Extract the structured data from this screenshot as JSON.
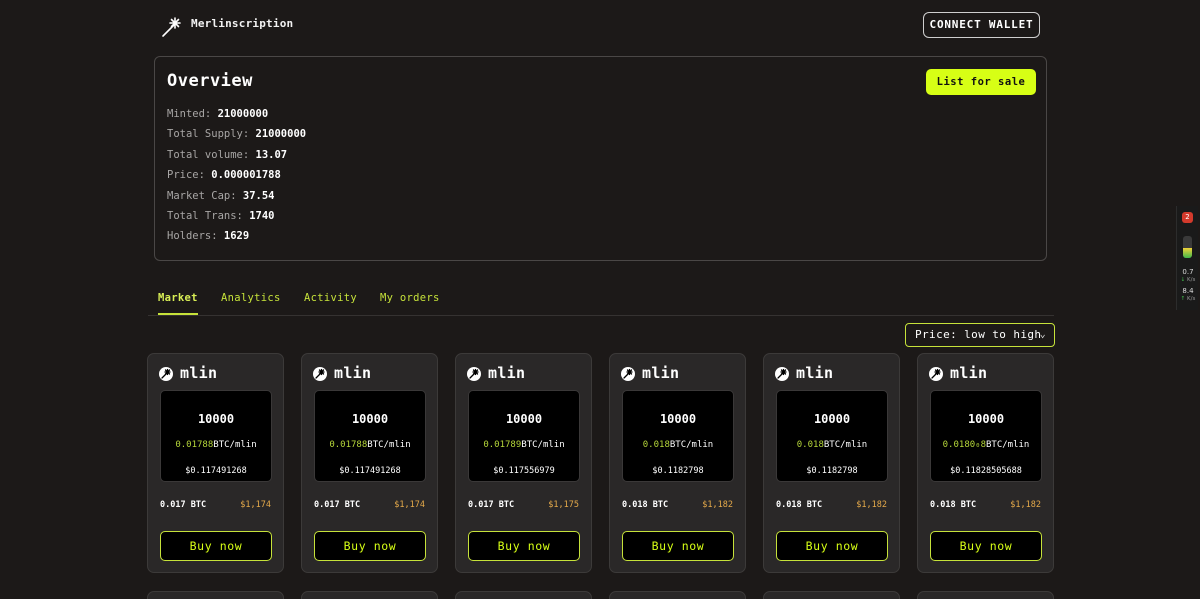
{
  "header": {
    "brand": "Merlinscription",
    "connect_label": "CONNECT WALLET"
  },
  "overview": {
    "title": "Overview",
    "list_button": "List for sale",
    "stats": [
      {
        "label": "Minted:",
        "value": "21000000"
      },
      {
        "label": "Total Supply:",
        "value": "21000000"
      },
      {
        "label": "Total volume:",
        "value": "13.07"
      },
      {
        "label": "Price:",
        "value": "0.000001788"
      },
      {
        "label": "Market Cap:",
        "value": "37.54"
      },
      {
        "label": "Total Trans:",
        "value": "1740"
      },
      {
        "label": "Holders:",
        "value": "1629"
      }
    ]
  },
  "tabs": [
    {
      "label": "Market",
      "active": true
    },
    {
      "label": "Analytics",
      "active": false
    },
    {
      "label": "Activity",
      "active": false
    },
    {
      "label": "My orders",
      "active": false
    }
  ],
  "sort": {
    "label": "Price: low to high"
  },
  "cards": [
    {
      "name": "mlin",
      "amount": "10000",
      "price": "0.01788",
      "unit": "BTC/mlin",
      "usd": "$0.117491268",
      "btc": "0.017 BTC",
      "total": "$1,174",
      "buy": "Buy now"
    },
    {
      "name": "mlin",
      "amount": "10000",
      "price": "0.01788",
      "unit": "BTC/mlin",
      "usd": "$0.117491268",
      "btc": "0.017 BTC",
      "total": "$1,174",
      "buy": "Buy now"
    },
    {
      "name": "mlin",
      "amount": "10000",
      "price": "0.01789",
      "unit": "BTC/mlin",
      "usd": "$0.117556979",
      "btc": "0.017 BTC",
      "total": "$1,175",
      "buy": "Buy now"
    },
    {
      "name": "mlin",
      "amount": "10000",
      "price": "0.018",
      "unit": "BTC/mlin",
      "usd": "$0.1182798",
      "btc": "0.018 BTC",
      "total": "$1,182",
      "buy": "Buy now"
    },
    {
      "name": "mlin",
      "amount": "10000",
      "price": "0.018",
      "unit": "BTC/mlin",
      "usd": "$0.1182798",
      "btc": "0.018 BTC",
      "total": "$1,182",
      "buy": "Buy now"
    },
    {
      "name": "mlin",
      "amount": "10000",
      "price": "0.0180₀8",
      "unit": "BTC/mlin",
      "usd": "$0.11828505688",
      "btc": "0.018 BTC",
      "total": "$1,182",
      "buy": "Buy now"
    }
  ],
  "widget": {
    "badge": "2",
    "level": 0.45,
    "down": "0.7",
    "down_unit": "K/s",
    "up": "8.4",
    "up_unit": "K/s"
  },
  "colors": {
    "accent": "#d7ff15",
    "tab": "#c6e23a",
    "background": "#1c1918",
    "card": "#2a2828",
    "usd": "#e4a94a"
  },
  "icons": {
    "logo": "sparkle-logo-icon",
    "chevron": "chevron-down-icon"
  }
}
